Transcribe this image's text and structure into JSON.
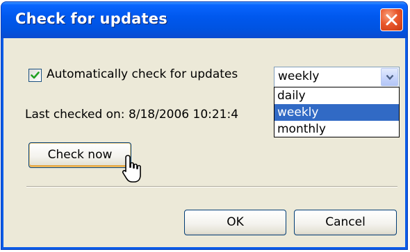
{
  "window": {
    "title": "Check for updates"
  },
  "settings": {
    "auto_check_label": "Automatically check for updates",
    "auto_check_checked": true,
    "frequency": {
      "selected": "weekly",
      "options": [
        "daily",
        "weekly",
        "monthly"
      ],
      "highlighted": "weekly"
    },
    "last_checked_label": "Last checked on: 8/18/2006 10:21:4"
  },
  "buttons": {
    "check_now": "Check now",
    "ok": "OK",
    "cancel": "Cancel"
  },
  "colors": {
    "title_bar": "#0058ee",
    "close_button": "#e9572b",
    "dialog_face": "#ece9d8",
    "selection": "#316ac5",
    "focus_border": "#e5a33a"
  },
  "icons": {
    "close": "close-icon",
    "checkmark": "checkmark-icon",
    "dropdown_arrow": "chevron-down-icon",
    "pointer": "hand-pointer-icon"
  }
}
